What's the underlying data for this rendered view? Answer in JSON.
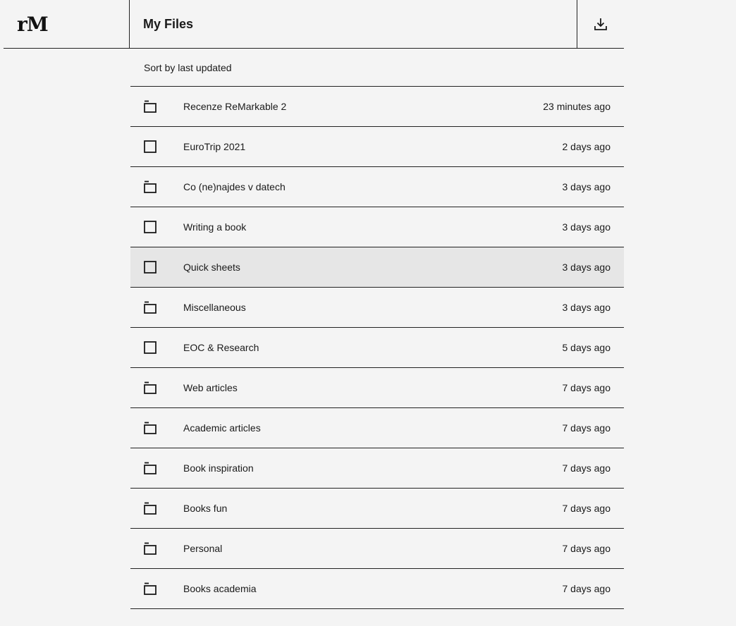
{
  "app": {
    "logo_text": "rM",
    "title": "My Files",
    "download_icon": "download-icon"
  },
  "sort": {
    "label": "Sort by last updated"
  },
  "files": [
    {
      "name": "Recenze ReMarkable 2",
      "updated": "23 minutes ago",
      "type": "folder",
      "selected": false
    },
    {
      "name": "EuroTrip 2021",
      "updated": "2 days ago",
      "type": "notebook",
      "selected": false
    },
    {
      "name": "Co (ne)najdes v datech",
      "updated": "3 days ago",
      "type": "folder",
      "selected": false
    },
    {
      "name": "Writing a book",
      "updated": "3 days ago",
      "type": "notebook",
      "selected": false
    },
    {
      "name": "Quick sheets",
      "updated": "3 days ago",
      "type": "notebook",
      "selected": true
    },
    {
      "name": "Miscellaneous",
      "updated": "3 days ago",
      "type": "folder",
      "selected": false
    },
    {
      "name": "EOC & Research",
      "updated": "5 days ago",
      "type": "notebook",
      "selected": false
    },
    {
      "name": "Web articles",
      "updated": "7 days ago",
      "type": "folder",
      "selected": false
    },
    {
      "name": "Academic articles",
      "updated": "7 days ago",
      "type": "folder",
      "selected": false
    },
    {
      "name": "Book inspiration",
      "updated": "7 days ago",
      "type": "folder",
      "selected": false
    },
    {
      "name": "Books fun",
      "updated": "7 days ago",
      "type": "folder",
      "selected": false
    },
    {
      "name": "Personal",
      "updated": "7 days ago",
      "type": "folder",
      "selected": false
    },
    {
      "name": "Books academia",
      "updated": "7 days ago",
      "type": "folder",
      "selected": false
    }
  ]
}
